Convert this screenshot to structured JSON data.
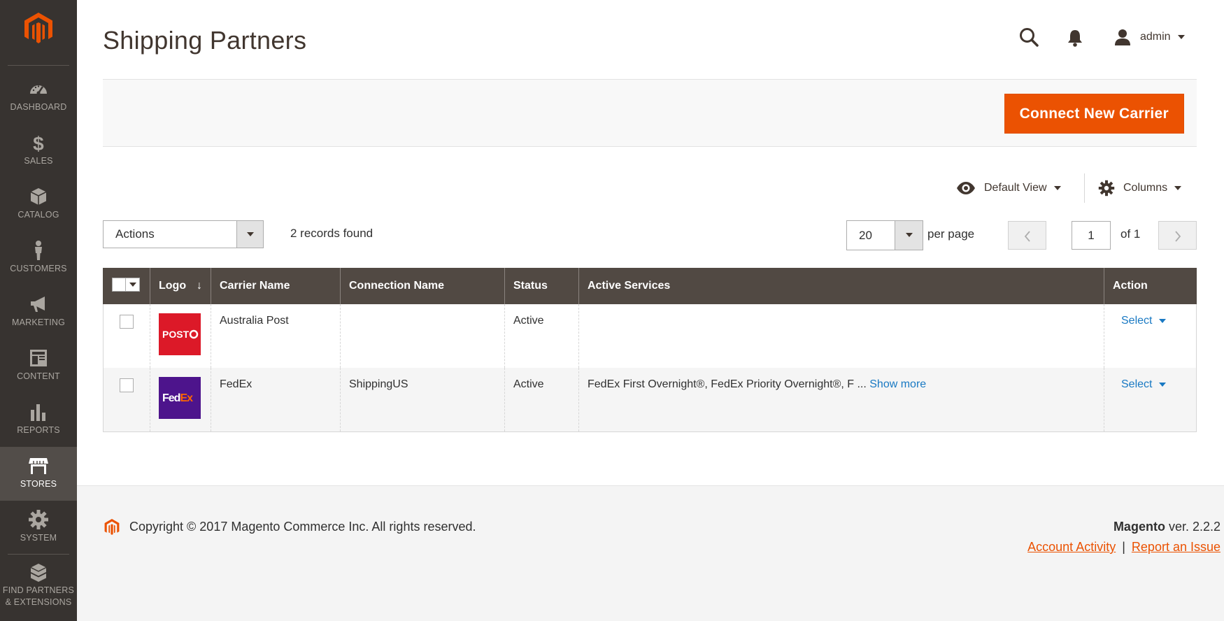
{
  "sidebar": {
    "logo_icon": "magento-logo-icon",
    "items": [
      {
        "label": "DASHBOARD",
        "icon": "dashboard-icon"
      },
      {
        "label": "SALES",
        "icon": "dollar-icon"
      },
      {
        "label": "CATALOG",
        "icon": "box-icon"
      },
      {
        "label": "CUSTOMERS",
        "icon": "person-icon"
      },
      {
        "label": "MARKETING",
        "icon": "megaphone-icon"
      },
      {
        "label": "CONTENT",
        "icon": "content-icon"
      },
      {
        "label": "REPORTS",
        "icon": "bar-chart-icon"
      },
      {
        "label": "STORES",
        "icon": "store-icon",
        "active": true
      },
      {
        "label": "SYSTEM",
        "icon": "gear-icon"
      },
      {
        "label": "FIND PARTNERS",
        "label2": "& EXTENSIONS",
        "icon": "blocks-icon"
      }
    ]
  },
  "header": {
    "title": "Shipping Partners",
    "user": "admin"
  },
  "action_bar": {
    "connect_button": "Connect New Carrier"
  },
  "toolbar": {
    "view_label": "Default View",
    "columns_label": "Columns",
    "actions_label": "Actions",
    "records_found": "2 records found",
    "per_page_value": "20",
    "per_page_label": "per page",
    "current_page": "1",
    "page_of": "of 1"
  },
  "table": {
    "headers": {
      "logo": "Logo",
      "sort_indicator": "↓",
      "carrier_name": "Carrier Name",
      "connection_name": "Connection Name",
      "status": "Status",
      "active_services": "Active Services",
      "action": "Action"
    },
    "rows": [
      {
        "logo": "australia-post-logo",
        "carrier_name": "Australia Post",
        "connection_name": "",
        "status": "Active",
        "active_services": "",
        "show_more": "",
        "action": "Select"
      },
      {
        "logo": "fedex-logo",
        "carrier_name": "FedEx",
        "connection_name": "ShippingUS",
        "status": "Active",
        "active_services": "FedEx First Overnight®, FedEx Priority Overnight®, F ... ",
        "show_more": "Show more",
        "action": "Select"
      }
    ],
    "logo_texts": {
      "australia_post": "POST",
      "fedex_fed": "Fed",
      "fedex_ex": "Ex"
    }
  },
  "footer": {
    "copyright": "Copyright © 2017 Magento Commerce Inc. All rights reserved.",
    "brand": "Magento",
    "version": " ver. 2.2.2",
    "account_activity": "Account Activity",
    "separator": "|",
    "report_issue": "Report an Issue"
  },
  "colors": {
    "sidebar_bg": "#373330",
    "sidebar_active": "#524d49",
    "accent": "#eb5202",
    "table_header": "#514943",
    "link": "#1979c3"
  }
}
